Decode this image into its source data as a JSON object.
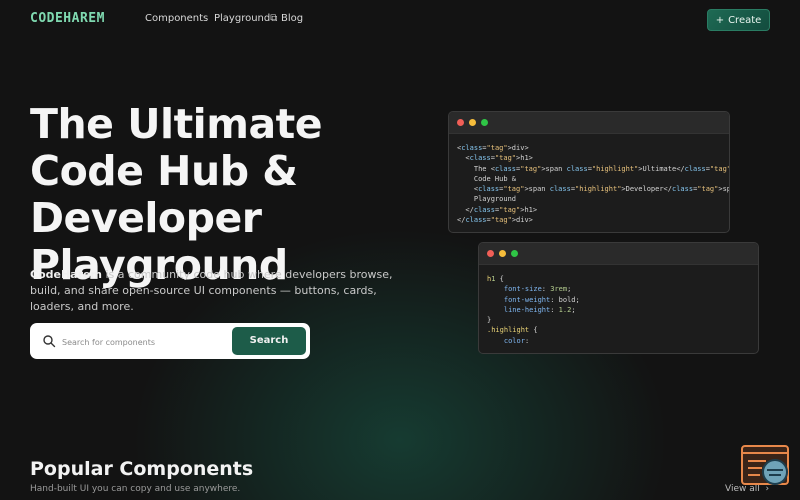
{
  "nav": {
    "logo": "CODEHAREM",
    "links": [
      "Components",
      "Playground⧉",
      "Blog"
    ],
    "create_label": "Create",
    "create_icon": "plus-icon"
  },
  "hero": {
    "title": "The Ultimate Code Hub & Developer Playground",
    "brand": "CodeHarem",
    "description": " is a community code hub where developers browse, build, and share open-source UI components — buttons, cards, loaders, and more.",
    "search_placeholder": "Search for components",
    "search_icon": "search-icon",
    "search_button": "Search"
  },
  "code_window_1": {
    "lines": [
      {
        "t": "<div>"
      },
      {
        "t": "  <h1>"
      },
      {
        "t": "    The <span class=\"highlight\">Ultimate</span>"
      },
      {
        "t": "    Code Hub &"
      },
      {
        "t": "    <span class=\"highlight\">Developer</span>"
      },
      {
        "t": "    Playground"
      },
      {
        "t": "  </h1>"
      },
      {
        "t": "</div>"
      }
    ]
  },
  "code_window_2": {
    "lines": [
      {
        "t": "h1 {"
      },
      {
        "t": "    font-size: 3rem;"
      },
      {
        "t": "    font-weight: bold;"
      },
      {
        "t": "    line-height: 1.2;"
      },
      {
        "t": "}"
      },
      {
        "t": ".highlight {"
      },
      {
        "t": "    color:"
      }
    ]
  },
  "popular": {
    "title": "Popular Components",
    "subtitle": "Hand-built UI you can copy and use anywhere.",
    "view_all": "View all",
    "view_all_icon": "chevron-right-icon"
  },
  "colors": {
    "background": "#131313",
    "accent": "#1d5c49",
    "logo": "#7fd9b0"
  }
}
